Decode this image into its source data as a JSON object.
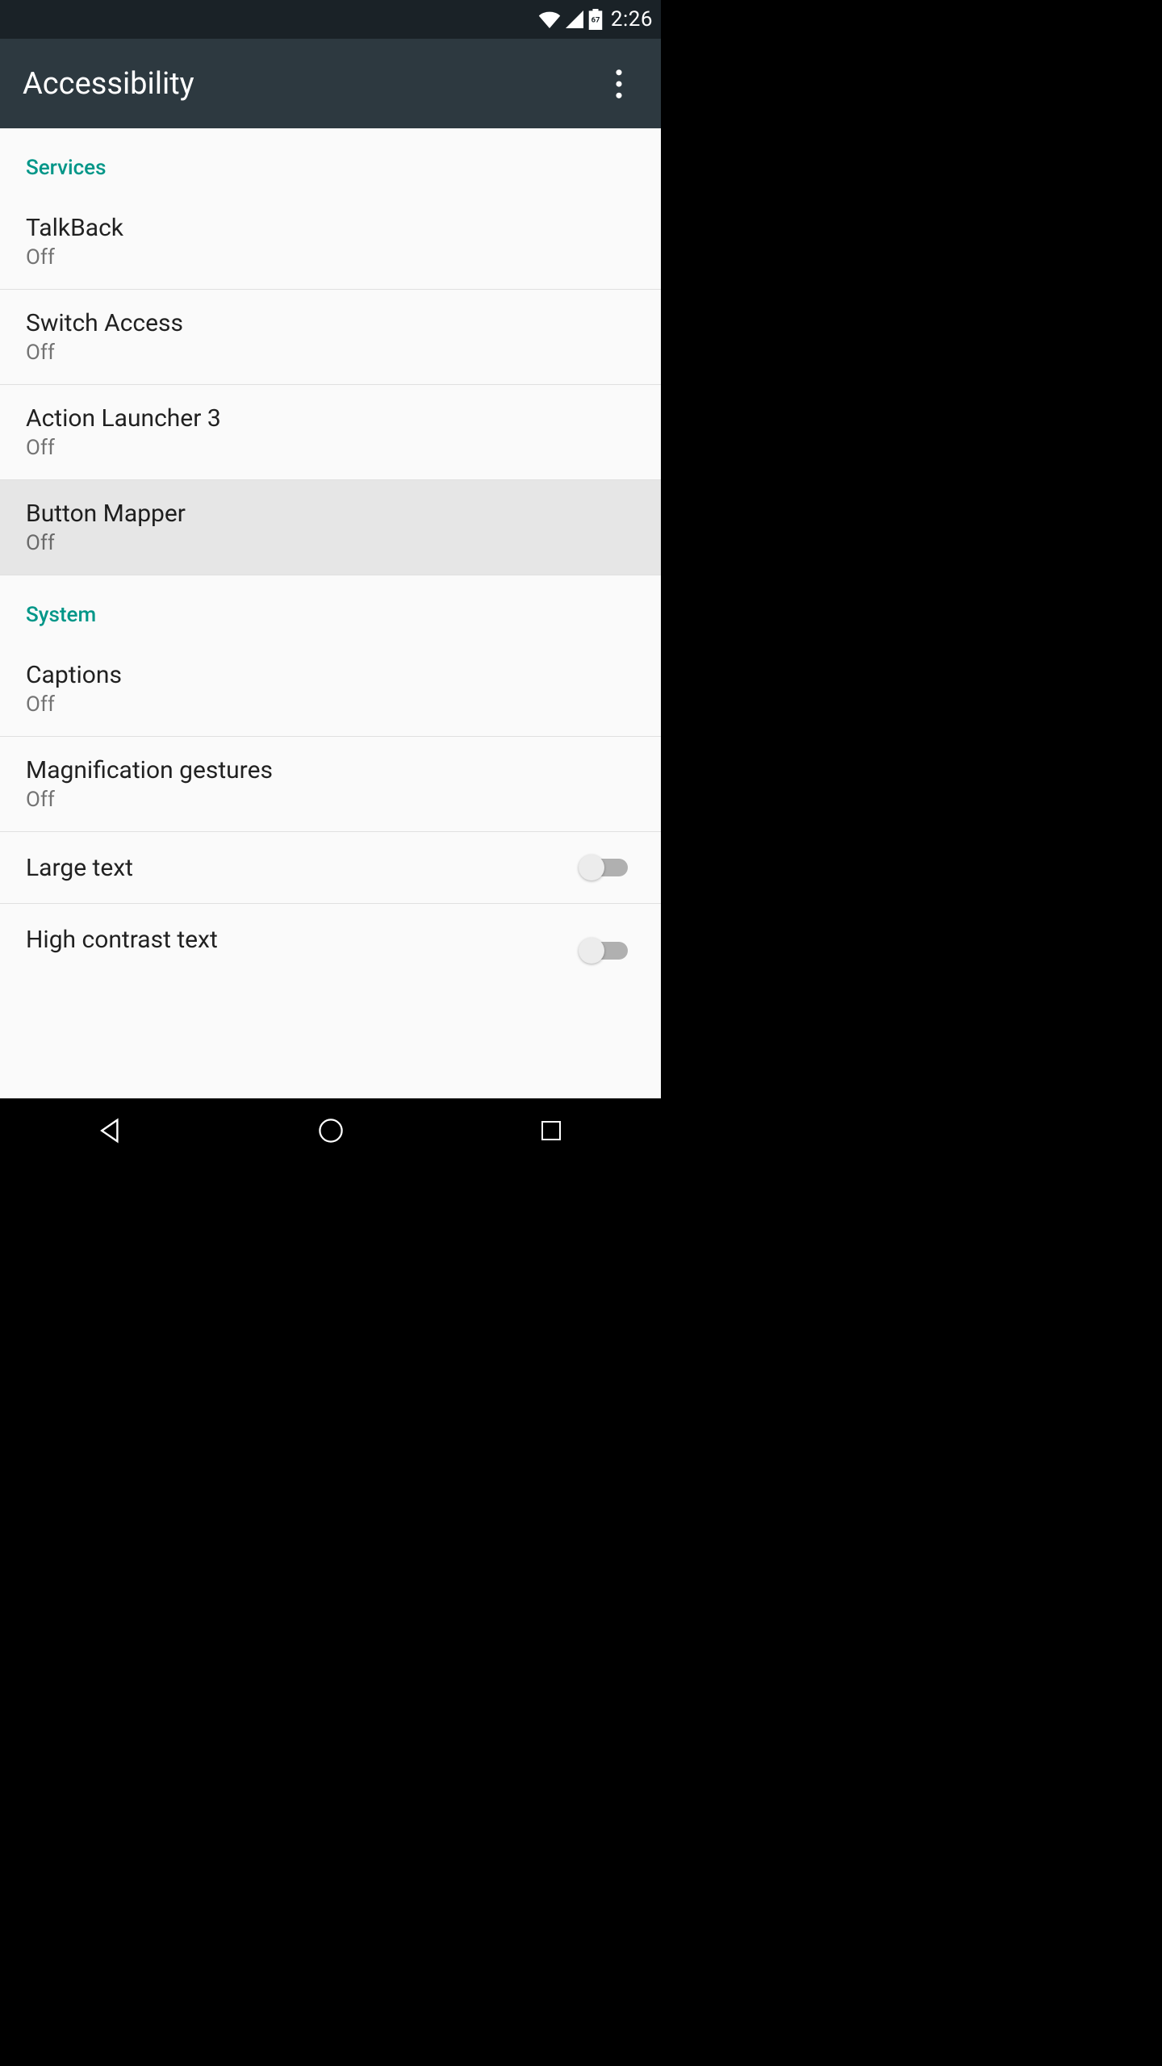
{
  "status": {
    "time": "2:26",
    "battery": "67"
  },
  "header": {
    "title": "Accessibility"
  },
  "sections": {
    "services": {
      "label": "Services",
      "items": [
        {
          "label": "TalkBack",
          "status": "Off"
        },
        {
          "label": "Switch Access",
          "status": "Off"
        },
        {
          "label": "Action Launcher 3",
          "status": "Off"
        },
        {
          "label": "Button Mapper",
          "status": "Off"
        }
      ]
    },
    "system": {
      "label": "System",
      "items": [
        {
          "label": "Captions",
          "status": "Off"
        },
        {
          "label": "Magnification gestures",
          "status": "Off"
        },
        {
          "label": "Large text"
        },
        {
          "label": "High contrast text"
        }
      ]
    }
  }
}
